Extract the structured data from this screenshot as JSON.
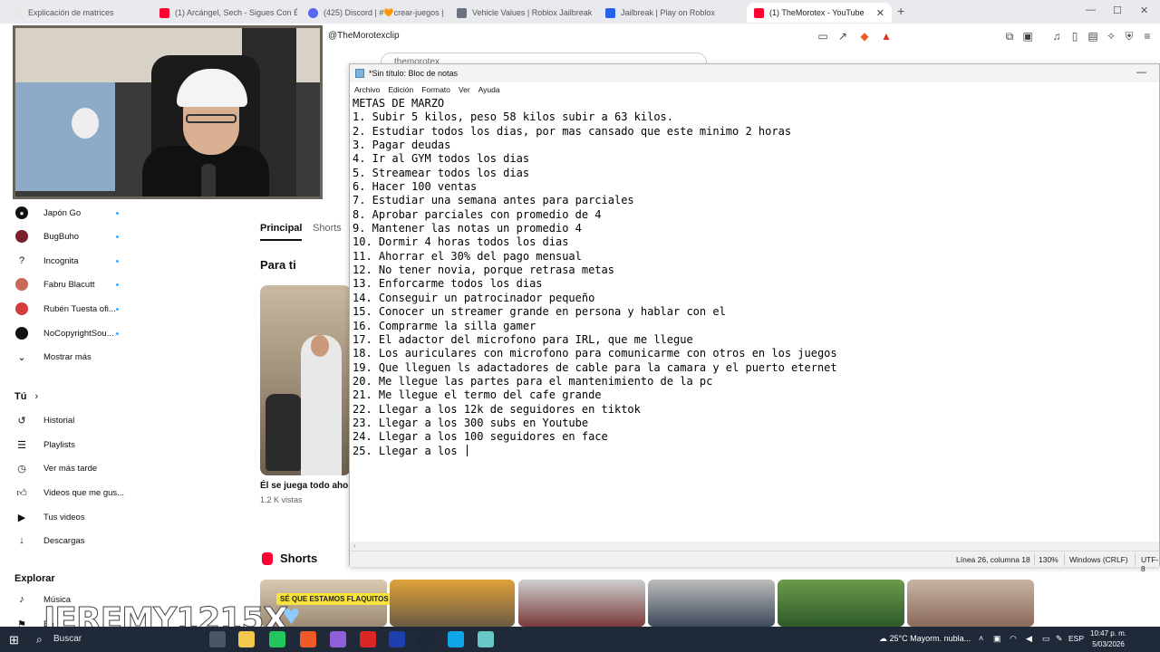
{
  "browser": {
    "tabs": [
      {
        "title": "Explicación de matrices",
        "color": "#e8e8e8"
      },
      {
        "title": "(1) Arcángel, Sech - Sigues Con É",
        "color": "#ff0033"
      },
      {
        "title": "(425) Discord | #🧡crear-juegos | Th",
        "color": "#5865f2"
      },
      {
        "title": "Vehicle Values | Roblox Jailbreak Trad",
        "color": "#6b7280"
      },
      {
        "title": "Jailbreak | Play on Roblox",
        "color": "#2563eb"
      },
      {
        "title": "(1) TheMorotex - YouTube",
        "color": "#ff0033"
      }
    ],
    "new_tab": "+",
    "close": "✕",
    "url": "@TheMorotexclip",
    "window_controls": [
      "—",
      "☐",
      "✕"
    ]
  },
  "youtube": {
    "search_value": "themorotex",
    "sidebar": {
      "channels": [
        {
          "label": "Japón Go",
          "icon": "avatar-icon",
          "color": "#111111"
        },
        {
          "label": "BugBuho",
          "icon": "avatar-icon",
          "color": "#7a1f2b"
        },
        {
          "label": "Incognita",
          "icon": "question-icon",
          "color": "#ffffff"
        },
        {
          "label": "Fabru Blacutt",
          "icon": "avatar-icon",
          "color": "#c96b5b"
        },
        {
          "label": "Rubén Tuesta ofi...",
          "icon": "avatar-icon",
          "color": "#d63c3c"
        },
        {
          "label": "NoCopyrightSou...",
          "icon": "avatar-icon",
          "color": "#111111"
        }
      ],
      "show_more": "Mostrar más",
      "you_header": "Tú",
      "you_items": [
        {
          "label": "Historial",
          "icon": "history-icon"
        },
        {
          "label": "Playlists",
          "icon": "playlist-icon"
        },
        {
          "label": "Ver más tarde",
          "icon": "clock-icon"
        },
        {
          "label": "Videos que me gus...",
          "icon": "thumbs-up-icon"
        },
        {
          "label": "Tus videos",
          "icon": "video-icon"
        },
        {
          "label": "Descargas",
          "icon": "download-icon"
        }
      ],
      "explore_header": "Explorar",
      "explore_items": [
        {
          "label": "Música",
          "icon": "music-icon"
        },
        {
          "label": "En",
          "icon": "trending-icon"
        }
      ]
    },
    "tabs": {
      "active": "Principal",
      "other": "Shorts"
    },
    "section_title": "Para ti",
    "video": {
      "title": "Él se juega todo ahor",
      "meta": "1.2 K vistas"
    },
    "shorts_title": "Shorts",
    "short_caption": "SÉ QUE ESTAMOS FLAQUITOS"
  },
  "notepad": {
    "title": "*Sin título: Bloc de notas",
    "menu": [
      "Archivo",
      "Edición",
      "Formato",
      "Ver",
      "Ayuda"
    ],
    "lines": [
      "METAS DE MARZO",
      "1. Subir 5 kilos, peso 58 kilos subir a 63 kilos.",
      "2. Estudiar todos los dias, por mas cansado que este minimo 2 horas",
      "3. Pagar deudas",
      "4. Ir al GYM todos los dias",
      "5. Streamear todos los dias",
      "6. Hacer 100 ventas",
      "7. Estudiar una semana antes para parciales",
      "8. Aprobar parciales con promedio de 4",
      "9. Mantener las notas un promedio 4",
      "10. Dormir 4 horas todos los dias",
      "11. Ahorrar el 30% del pago mensual",
      "12. No tener novia, porque retrasa metas",
      "13. Enforcarme todos los dias",
      "14. Conseguir un patrocinador pequeño",
      "15. Conocer un streamer grande en persona y hablar con el",
      "16. Comprarme la silla gamer",
      "17. El adactor del microfono para IRL, que me llegue",
      "18. Los auriculares con microfono para comunicarme con otros en los juegos",
      "19. Que lleguen ls adactadores de cable para la camara y el puerto eternet",
      "20. Me llegue las partes para el mantenimiento de la pc",
      "21. Me llegue el termo del cafe grande",
      "22. Llegar a los 12k de seguidores en tiktok",
      "23. Llegar a los 300 subs en Youtube",
      "24. Llegar a los 100 seguidores en face",
      "25. Llegar a los "
    ],
    "status": {
      "position": "Línea 26, columna 18",
      "zoom": "130%",
      "line_ending": "Windows (CRLF)",
      "encoding": "UTF-8"
    }
  },
  "overlay": {
    "brand": "JEREMY1215X",
    "heart": "♥"
  },
  "taskbar": {
    "search": "Buscar",
    "weather": "25°C  Mayorm. nubla...",
    "lang": "ESP",
    "time": "10:47 p. m.",
    "date": "5/03/2026",
    "apps": [
      {
        "name": "task-view-icon",
        "color": "#4b5563"
      },
      {
        "name": "file-explorer-icon",
        "color": "#f2c94c"
      },
      {
        "name": "store-icon",
        "color": "#22c55e"
      },
      {
        "name": "brave-browser-icon",
        "color": "#f05a28"
      },
      {
        "name": "visual-studio-icon",
        "color": "#8e5fd6"
      },
      {
        "name": "app-red-icon",
        "color": "#dc2626"
      },
      {
        "name": "app-blue-icon",
        "color": "#1e40af"
      },
      {
        "name": "steam-icon",
        "color": "#1b2838"
      },
      {
        "name": "app-cyan-icon",
        "color": "#0ea5e9"
      },
      {
        "name": "notepad-icon",
        "color": "#67c7c7"
      }
    ]
  }
}
